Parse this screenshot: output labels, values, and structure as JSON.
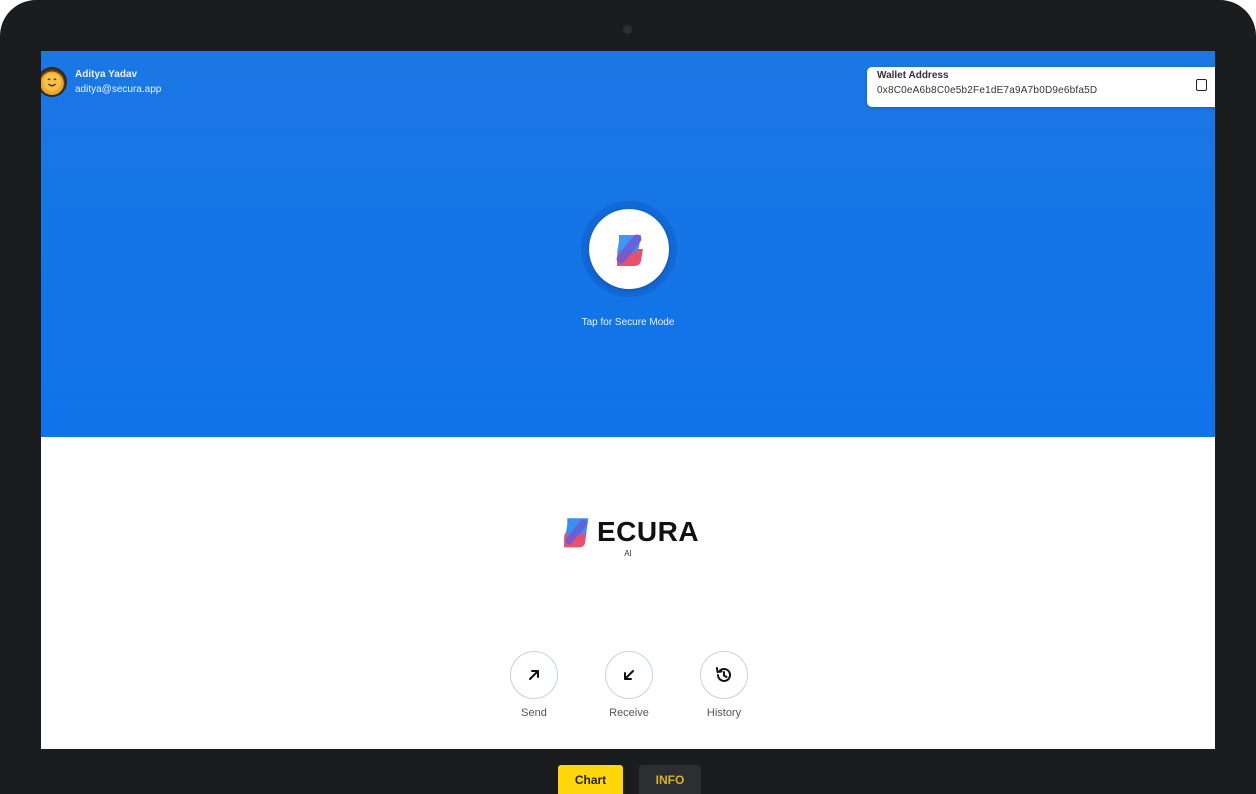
{
  "profile": {
    "avatar_icon": "smiley-avatar-icon",
    "name": "Aditya Yadav",
    "email": "aditya@secura.app"
  },
  "wallet": {
    "label": "Wallet Address",
    "address": "0x8C0eA6b8C0e5b2Fe1dE7a9A7b0D9e6bfa5D",
    "copy_icon": "copy-icon"
  },
  "hero": {
    "logo_icon": "secura-logo-icon",
    "tap_text": "Tap for Secure Mode"
  },
  "brand": {
    "name": "ECURA",
    "sub": "AI"
  },
  "actions": [
    {
      "label": "Send",
      "icon": "arrow-up-right-icon"
    },
    {
      "label": "Receive",
      "icon": "arrow-down-left-icon"
    },
    {
      "label": "History",
      "icon": "history-icon"
    }
  ],
  "tabs": {
    "chart": "Chart",
    "info": "INFO"
  },
  "colors": {
    "hero_blue": "#1274e8",
    "accent_yellow": "#ffd60a",
    "logo_blue": "#3a8ef0",
    "logo_pink": "#e8506e"
  }
}
